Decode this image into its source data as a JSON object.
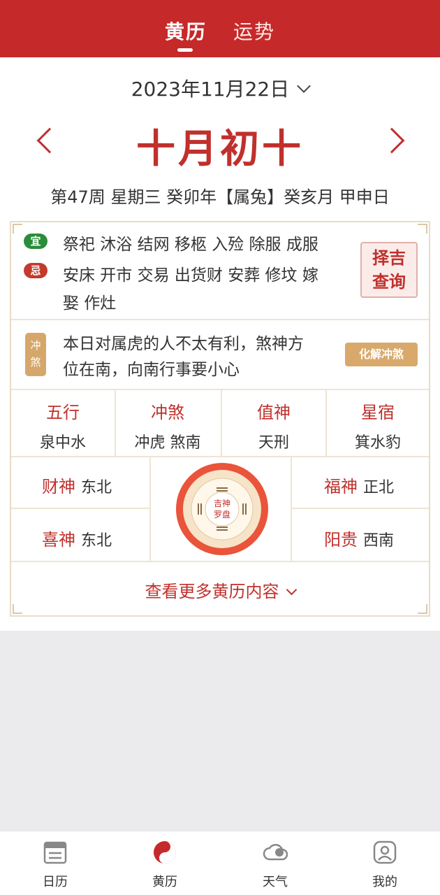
{
  "header": {
    "tabs": [
      {
        "label": "黄历"
      },
      {
        "label": "运势"
      }
    ]
  },
  "date": {
    "solar": "2023年11月22日",
    "lunar": "十月初十",
    "ganzhi": "第47周 星期三 癸卯年【属兔】癸亥月 甲申日"
  },
  "yiji": {
    "yi_badge": "宜",
    "yi": "祭祀 沐浴 结网 移柩 入殓 除服 成服",
    "ji_badge": "忌",
    "ji_line1": "安床 开市 交易 出货财 安葬 修坟 嫁",
    "ji_line2": "娶 作灶",
    "zeji_line1": "择吉",
    "zeji_line2": "查询"
  },
  "chongsha": {
    "badge1": "冲",
    "badge2": "煞",
    "text_line1": "本日对属虎的人不太有利，煞神方",
    "text_line2": "位在南，向南行事要小心",
    "button": "化解冲煞"
  },
  "attributes": [
    {
      "label": "五行",
      "value": "泉中水"
    },
    {
      "label": "冲煞",
      "value": "冲虎 煞南"
    },
    {
      "label": "值神",
      "value": "天刑"
    },
    {
      "label": "星宿",
      "value": "箕水豹"
    }
  ],
  "gods": {
    "caishen": {
      "label": "财神",
      "value": "东北"
    },
    "xishen": {
      "label": "喜神",
      "value": "东北"
    },
    "fushen": {
      "label": "福神",
      "value": "正北"
    },
    "yanggui": {
      "label": "阳贵",
      "value": "西南"
    }
  },
  "luopan": {
    "line1": "吉神",
    "line2": "罗盘"
  },
  "more": {
    "label": "查看更多黄历内容"
  },
  "bottom_nav": [
    {
      "label": "日历"
    },
    {
      "label": "黄历"
    },
    {
      "label": "天气"
    },
    {
      "label": "我的"
    }
  ],
  "colors": {
    "primary": "#c6292a",
    "accent": "#c0302c",
    "gold": "#d9a96c",
    "green": "#2b8c3c"
  }
}
